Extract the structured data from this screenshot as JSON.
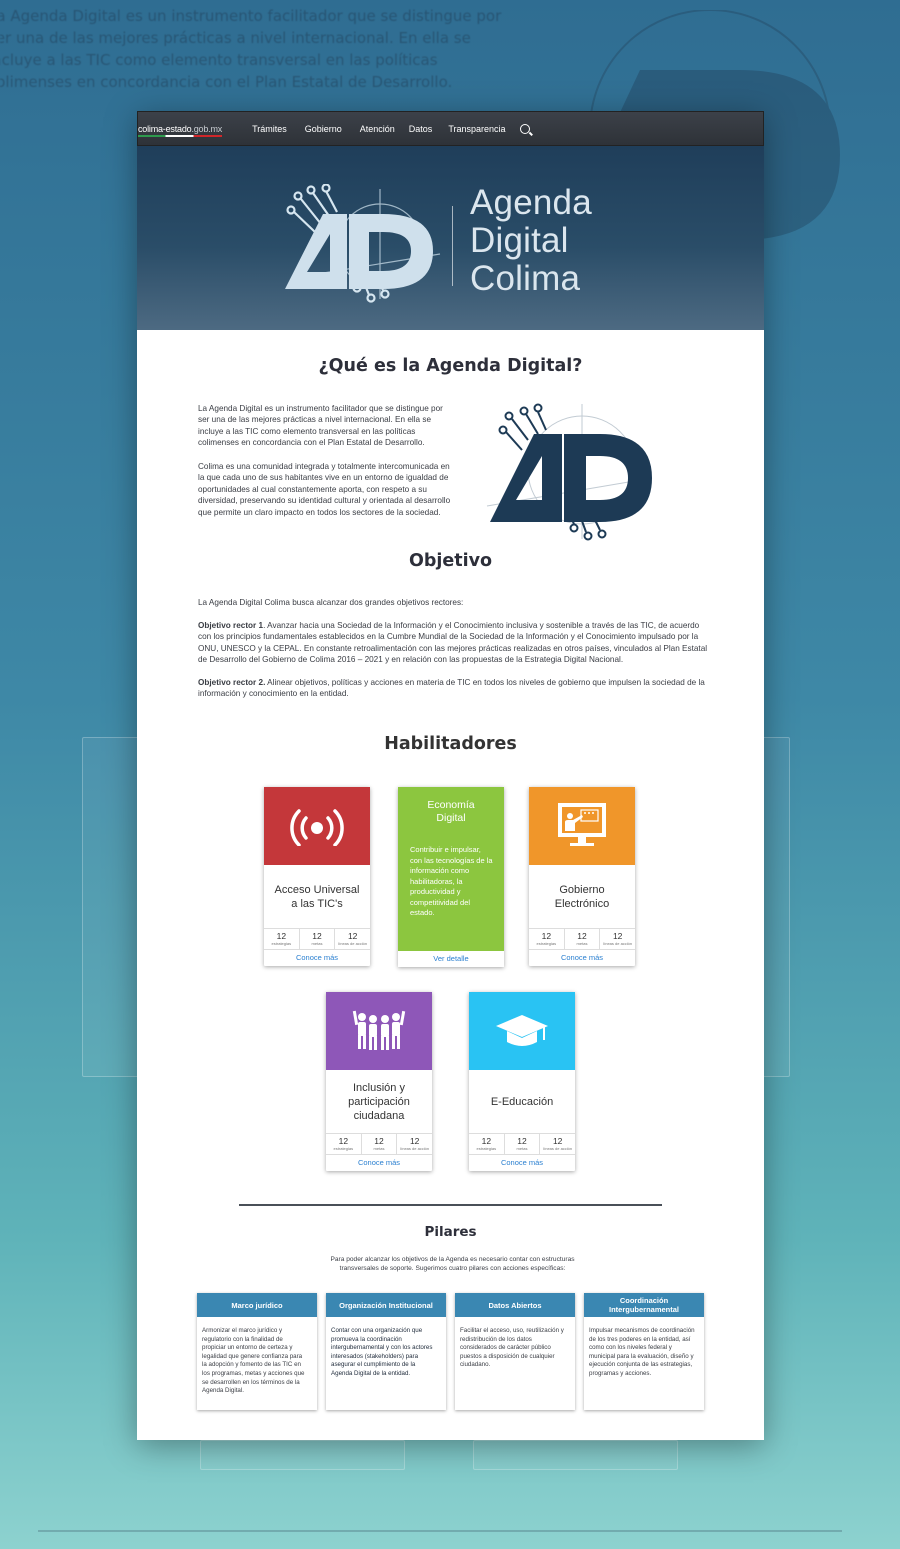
{
  "nav": {
    "brand_main": "colima-estado",
    "brand_suffix": ".gob.mx",
    "links": [
      "Trámites",
      "Gobierno",
      "Atención",
      "Datos",
      "Transparencia"
    ]
  },
  "hero": {
    "title_lines": [
      "Agenda",
      "Digital",
      "Colima"
    ]
  },
  "what": {
    "title": "¿Qué es la Agenda Digital?",
    "p1": "La Agenda Digital es un instrumento facilitador que se distingue por ser una de las mejores prácticas a nivel internacional. En ella se incluye a las TIC como elemento transversal en las políticas colimenses en concordancia con el Plan Estatal de Desarrollo.",
    "p2": "Colima es una comunidad integrada y totalmente intercomunicada en la que cada uno de sus habitantes vive en un entorno de igualdad de oportunidades al cual constantemente aporta, con respeto a su diversidad, preservando su identidad cultural y orientada al desarrollo que permite un claro impacto en todos los sectores de la sociedad."
  },
  "objective": {
    "title": "Objetivo",
    "intro": "La Agenda Digital Colima busca alcanzar dos grandes objetivos rectores:",
    "o1_label": "Objetivo rector 1",
    "o1_text": ". Avanzar hacia una Sociedad de la Información y el Conocimiento inclusiva y sostenible a través de las TIC, de acuerdo con los principios fundamentales establecidos en la Cumbre Mundial de la Sociedad de la Información y el Conocimiento impulsado por la ONU, UNESCO y la CEPAL. En constante retroalimentación con las mejores prácticas realizadas en otros países, vinculados al Plan Estatal de Desarrollo del Gobierno de Colima 2016 – 2021 y en relación con las propuestas de la Estrategia Digital Nacional.",
    "o2_label": "Objetivo rector 2.",
    "o2_text": " Alinear objetivos, políticas y acciones en materia de TIC en todos los niveles de gobierno que impulsen la sociedad de la información y conocimiento en la entidad."
  },
  "enablers": {
    "title": "Habilitadores",
    "stat_labels": [
      "estrategias",
      "metas",
      "líneas de acción"
    ],
    "cards": [
      {
        "name": "Acceso Universal a las TIC's",
        "color": "#c4373a",
        "icon": "signal-broadcast-icon",
        "stats": [
          "12",
          "12",
          "12"
        ],
        "link": "Conoce más"
      },
      {
        "name": "Gobierno Electrónico",
        "color": "#f0962a",
        "icon": "presentation-screen-icon",
        "stats": [
          "12",
          "12",
          "12"
        ],
        "link": "Conoce más"
      },
      {
        "name": "Inclusión y participación ciudadana",
        "color": "#8e57b8",
        "icon": "people-group-icon",
        "stats": [
          "12",
          "12",
          "12"
        ],
        "link": "Conoce más"
      },
      {
        "name": "E-Educación",
        "color": "#29c3f3",
        "icon": "graduation-cap-icon",
        "stats": [
          "12",
          "12",
          "12"
        ],
        "link": "Conoce más"
      }
    ],
    "featured": {
      "title": "Economía Digital",
      "description": "Contribuir e impulsar, con las tecnologías de la información como habilitadoras, la productividad y competitividad del estado.",
      "link": "Ver detalle",
      "color": "#8cc63f"
    }
  },
  "pillars": {
    "title": "Pilares",
    "intro": "Para poder alcanzar los objetivos de la Agenda es necesario contar con estructuras transversales de soporte. Sugerimos cuatro pilares con acciones específicas:",
    "items": [
      {
        "title": "Marco jurídico",
        "text": "Armonizar el marco jurídico y regulatorio con la finalidad de propiciar un entorno de certeza y legalidad que genere confianza para la adopción y fomento de las TIC en los programas, metas y acciones que se desarrollen en los términos de la Agenda Digital."
      },
      {
        "title": "Organización Institucional",
        "text": "Contar con una organización que promueva la coordinación intergubernamental y con los actores interesados (stakeholders) para asegurar el cumplimiento de la Agenda Digital de la entidad."
      },
      {
        "title": "Datos Abiertos",
        "text": "Facilitar el acceso, uso, reutilización y redistribución de los datos considerados de carácter público puestos a disposición de cualquier ciudadano."
      },
      {
        "title": "Coordinación Intergubernamental",
        "text": "Impulsar mecanismos de coordinación de los tres poderes en la entidad, así como con los niveles federal y municipal para la evaluación, diseño y ejecución conjunta de las estrategias, programas y acciones."
      }
    ]
  },
  "colors": {
    "pillar_header": "#3a87b2",
    "nav_bg": "#33373d",
    "hero_bg": "#24445f",
    "link": "#2a7fd0",
    "logo_dark": "#1d3a55"
  }
}
